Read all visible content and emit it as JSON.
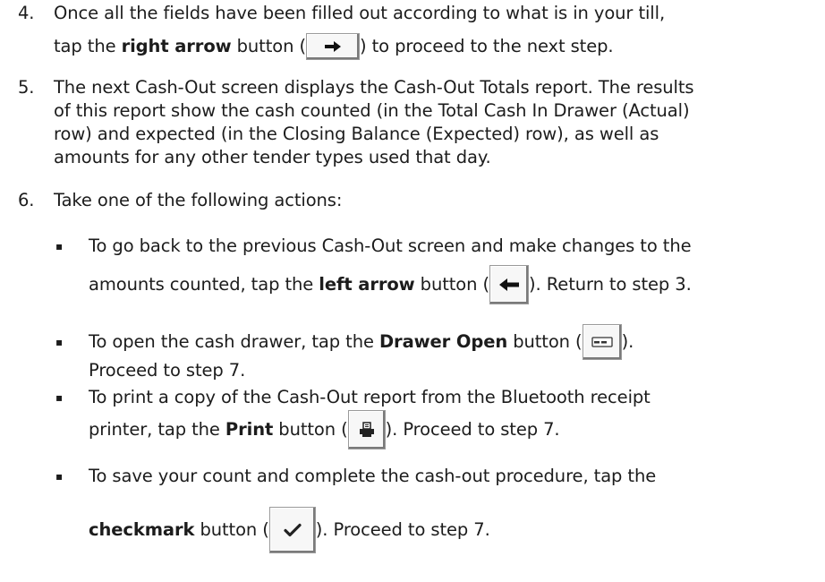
{
  "steps": [
    {
      "number": "4.",
      "line1": "Once all the fields have been filled out according to what is in your till,",
      "line2_pre": "tap the ",
      "line2_bold": "right arrow",
      "line2_mid": " button (",
      "button_icon": "right-arrow-icon",
      "line2_post": ") to proceed to the next step."
    },
    {
      "number": "5.",
      "lines": [
        "The next Cash-Out screen displays the Cash-Out Totals report. The results",
        "of this report show the cash counted (in the Total Cash In Drawer (Actual)",
        "row) and expected (in the Closing Balance (Expected) row), as well as",
        "amounts for any other tender types used that day."
      ]
    },
    {
      "number": "6.",
      "line1": "Take one of the following actions:"
    }
  ],
  "bullet_glyph": "▪",
  "bullets": [
    {
      "line1": "To go back to the previous Cash-Out screen and make changes to the",
      "pre": "amounts counted, tap the ",
      "bold": "left arrow",
      "mid": " button (",
      "button_icon": "left-arrow-icon",
      "post": "). Return to step 3."
    },
    {
      "pre": "To open the cash drawer, tap the ",
      "bold": "Drawer Open",
      "mid": " button (",
      "button_icon": "drawer-open-icon",
      "post": ").",
      "line2": "Proceed to step 7."
    },
    {
      "line1": "To print a copy of the Cash-Out report from the Bluetooth receipt",
      "pre": "printer, tap the ",
      "bold": "Print",
      "mid": " button (",
      "button_icon": "print-icon",
      "post": "). Proceed to step 7."
    },
    {
      "line1": "To save your count and complete the cash-out procedure, tap the",
      "bold": "checkmark",
      "mid": " button (",
      "button_icon": "checkmark-icon",
      "post": "). Proceed to step 7."
    }
  ]
}
